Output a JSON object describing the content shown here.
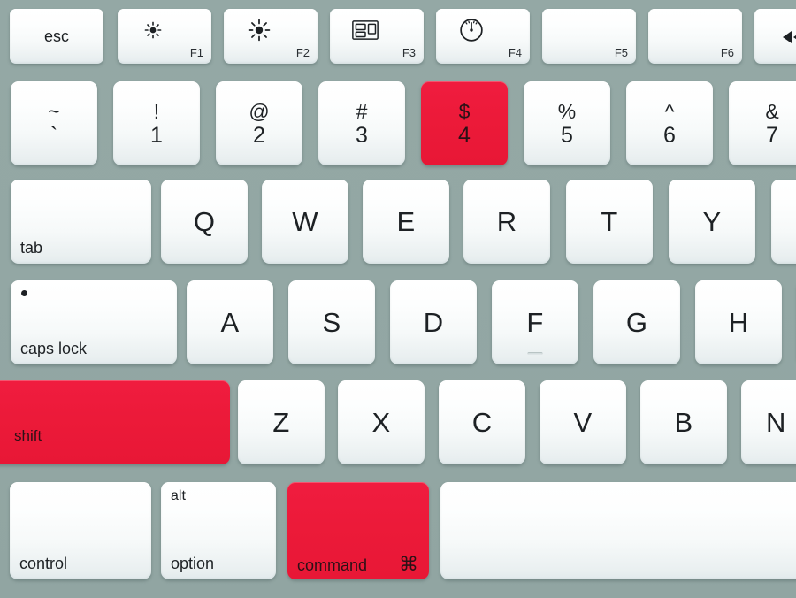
{
  "device": {
    "name": "Apple Mac laptop keyboard",
    "background_color": "#93a7a4",
    "key_color": "#fbfdfd",
    "highlight_color": "#ec1a39",
    "text_color": "#1d2124"
  },
  "highlighted_keys": [
    "$ 4",
    "shift",
    "command"
  ],
  "rows": {
    "function_row": {
      "name": "function-row",
      "keys": [
        {
          "label": "esc",
          "icon": "",
          "fn": "",
          "style": "word-center"
        },
        {
          "label": "",
          "icon": "brightness-down-icon",
          "fn": "F1",
          "style": "icon-fn"
        },
        {
          "label": "",
          "icon": "brightness-up-icon",
          "fn": "F2",
          "style": "icon-fn"
        },
        {
          "label": "",
          "icon": "mission-control-icon",
          "fn": "F3",
          "style": "icon-fn"
        },
        {
          "label": "",
          "icon": "dashboard-gauge-icon",
          "fn": "F4",
          "style": "icon-fn"
        },
        {
          "label": "",
          "icon": "",
          "fn": "F5",
          "style": "fn-only"
        },
        {
          "label": "",
          "icon": "",
          "fn": "F6",
          "style": "fn-only"
        },
        {
          "label": "",
          "icon": "rewind-icon",
          "fn": "",
          "style": "icon-only"
        }
      ]
    },
    "number_row": {
      "name": "number-row",
      "keys": [
        {
          "upper": "~",
          "lower": "`",
          "highlighted": false
        },
        {
          "upper": "!",
          "lower": "1",
          "highlighted": false
        },
        {
          "upper": "@",
          "lower": "2",
          "highlighted": false
        },
        {
          "upper": "#",
          "lower": "3",
          "highlighted": false
        },
        {
          "upper": "$",
          "lower": "4",
          "highlighted": true
        },
        {
          "upper": "%",
          "lower": "5",
          "highlighted": false
        },
        {
          "upper": "^",
          "lower": "6",
          "highlighted": false
        },
        {
          "upper": "&",
          "lower": "7",
          "highlighted": false
        }
      ]
    },
    "qwerty_row": {
      "name": "qwerty-row",
      "modifier": "tab",
      "keys": [
        "Q",
        "W",
        "E",
        "R",
        "T",
        "Y"
      ]
    },
    "home_row": {
      "name": "home-row",
      "modifier": "caps lock",
      "keys": [
        "A",
        "S",
        "D",
        "F",
        "G",
        "H"
      ]
    },
    "shift_row": {
      "name": "shift-row",
      "modifier": "shift",
      "modifier_highlighted": true,
      "keys": [
        "Z",
        "X",
        "C",
        "V",
        "B",
        "N"
      ]
    },
    "bottom_row": {
      "name": "bottom-row",
      "keys": [
        {
          "label": "control",
          "alt_label": "",
          "highlighted": false,
          "mark": ""
        },
        {
          "label": "option",
          "alt_label": "alt",
          "highlighted": false,
          "mark": ""
        },
        {
          "label": "command",
          "alt_label": "",
          "highlighted": true,
          "mark": "⌘"
        },
        {
          "label": "",
          "alt_label": "",
          "highlighted": false,
          "mark": ""
        }
      ]
    }
  }
}
